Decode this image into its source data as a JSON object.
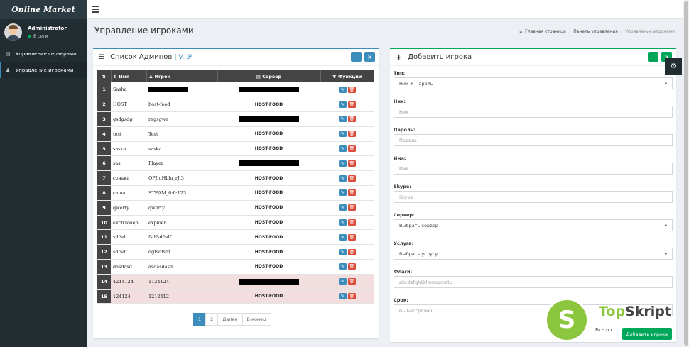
{
  "app": {
    "logo": "Online Market"
  },
  "user": {
    "name": "Administrator",
    "status": "В сети"
  },
  "sidebar": {
    "items": [
      {
        "label": "Управление серверами",
        "icon": "server-icon"
      },
      {
        "label": "Управление игроками",
        "icon": "user-icon"
      }
    ]
  },
  "page": {
    "title": "Управление игроками",
    "breadcrumb": [
      "Главная страница",
      "Панель управления",
      "Управление игроками"
    ]
  },
  "admins_box": {
    "title": "Список Админов",
    "tag": "V.I.P",
    "columns": [
      "Имя",
      "Игрок",
      "Сервер",
      "Функции"
    ],
    "rows": [
      {
        "num": "1",
        "name": "Sasha",
        "player": "",
        "server": "",
        "player_redacted": true,
        "server_redacted": true,
        "highlight": false
      },
      {
        "num": "2",
        "name": "HOST",
        "player": "host-food",
        "server": "HOST-FOOD",
        "highlight": false
      },
      {
        "num": "3",
        "name": "gsdgsdg",
        "player": "regsgwe",
        "server": "",
        "server_redacted": true,
        "highlight": false
      },
      {
        "num": "4",
        "name": "test",
        "player": "Test",
        "server": "HOST-FOOD",
        "highlight": false
      },
      {
        "num": "5",
        "name": "saska",
        "player": "saska",
        "server": "HOST-FOOD",
        "highlight": false
      },
      {
        "num": "6",
        "name": "sas",
        "player": "Player",
        "server": "",
        "server_redacted": true,
        "highlight": false
      },
      {
        "num": "7",
        "name": "сенька",
        "player": "OPJluHblu_rJl3",
        "server": "HOST-FOOD",
        "highlight": false
      },
      {
        "num": "8",
        "name": "саша",
        "player": "STEAM_0:0:123...",
        "server": "HOST-FOOD",
        "highlight": false
      },
      {
        "num": "9",
        "name": "qwerty",
        "player": "qwerty",
        "server": "HOST-FOOD",
        "highlight": false
      },
      {
        "num": "10",
        "name": "експловер",
        "player": "exploer",
        "server": "HOST-FOOD",
        "highlight": false
      },
      {
        "num": "11",
        "name": "sdfsd",
        "player": "fsdfsdfsdf",
        "server": "HOST-FOOD",
        "highlight": false
      },
      {
        "num": "12",
        "name": "sdfsdf",
        "player": "dgfsdfsdf",
        "server": "HOST-FOOD",
        "highlight": false
      },
      {
        "num": "13",
        "name": "dasdasd",
        "player": "asdasdasd",
        "server": "HOST-FOOD",
        "highlight": false
      },
      {
        "num": "14",
        "name": "4214124",
        "player": "1124124",
        "server": "",
        "server_redacted": true,
        "highlight": true
      },
      {
        "num": "15",
        "name": "124124",
        "player": "1212412",
        "server": "HOST-FOOD",
        "highlight": true
      }
    ],
    "pagination": [
      "1",
      "2",
      "Далее",
      "В конец"
    ]
  },
  "add_box": {
    "title": "Добавить игрока",
    "fields": [
      {
        "label": "Тип:",
        "value": "Ник + Пароль",
        "type": "select"
      },
      {
        "label": "Ник:",
        "value": "Ник",
        "type": "input"
      },
      {
        "label": "Пароль:",
        "value": "Пароль",
        "type": "input"
      },
      {
        "label": "Имя:",
        "value": "Имя",
        "type": "input"
      },
      {
        "label": "Skype:",
        "value": "Skype",
        "type": "input"
      },
      {
        "label": "Сервер:",
        "value": "Выбрать сервер",
        "type": "select"
      },
      {
        "label": "Услуга:",
        "value": "Выбрать услугу",
        "type": "select"
      },
      {
        "label": "Флаги:",
        "value": "abcdefghijklmnopqrstu",
        "type": "input"
      },
      {
        "label": "Срок:",
        "value": "0 - Бессрочно",
        "type": "input"
      }
    ],
    "submit": "Добавить игрока"
  },
  "watermark": {
    "letter": "S",
    "brand_a": "Top",
    "brand_b": "Skript",
    "sub": "Все о с"
  },
  "colors": {
    "primary": "#3c8dbc",
    "success": "#00a65a",
    "danger": "#dd4b39",
    "sidebar": "#222d32"
  }
}
